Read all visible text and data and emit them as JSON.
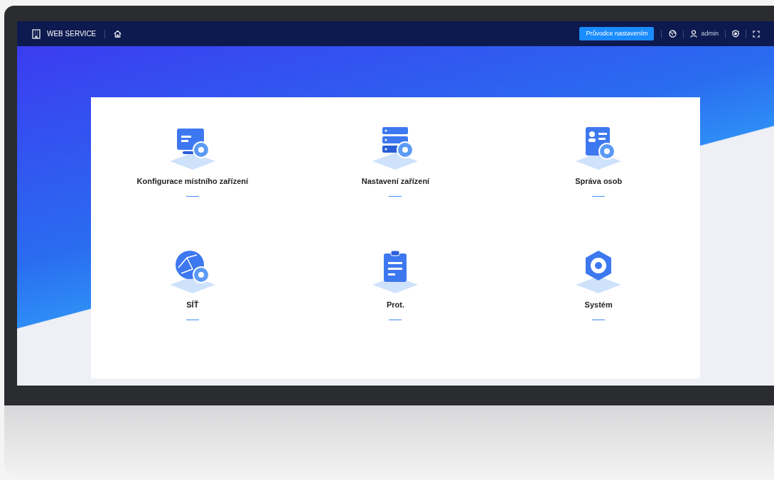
{
  "header": {
    "brand": "WEB SERVICE",
    "wizard_button": "Průvodce nastavením",
    "user": "admin"
  },
  "tiles": [
    {
      "kind": "monitor",
      "label": "Konfigurace místního zařízení"
    },
    {
      "kind": "server",
      "label": "Nastavení zařízení"
    },
    {
      "kind": "person",
      "label": "Správa osob"
    },
    {
      "kind": "globe",
      "label": "SÍŤ"
    },
    {
      "kind": "clipboard",
      "label": "Prot."
    },
    {
      "kind": "hexagon",
      "label": "Systém"
    }
  ]
}
